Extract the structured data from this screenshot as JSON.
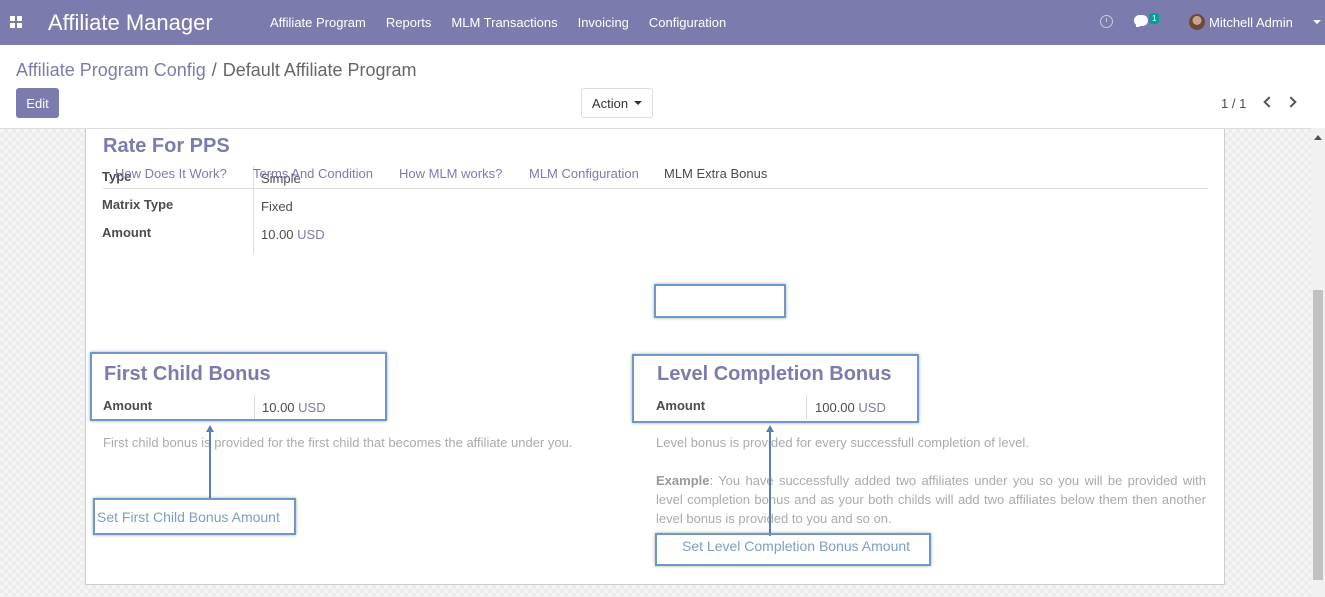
{
  "navbar": {
    "app_title": "Affiliate Manager",
    "menu": [
      "Affiliate Program",
      "Reports",
      "MLM Transactions",
      "Invoicing",
      "Configuration"
    ],
    "chat_badge": "1",
    "user_name": "Mitchell Admin"
  },
  "control": {
    "breadcrumb_parent": "Affiliate Program Config",
    "breadcrumb_sep": "/",
    "breadcrumb_current": "Default Affiliate Program",
    "edit_label": "Edit",
    "action_label": "Action",
    "pager": "1 / 1"
  },
  "rate_pps": {
    "title": "Rate For PPS",
    "type_label": "Type",
    "type_value": "Simple",
    "matrix_label": "Matrix Type",
    "matrix_value": "Fixed",
    "amount_label": "Amount",
    "amount_value": "10.00",
    "amount_currency": "USD"
  },
  "tabs": [
    "How Does It Work?",
    "Terms And Condition",
    "How MLM works?",
    "MLM Configuration",
    "MLM Extra Bonus"
  ],
  "first_child": {
    "title": "First Child Bonus",
    "amount_label": "Amount",
    "amount_value": "10.00",
    "currency": "USD",
    "description": "First child bonus is provided for the first child that becomes the affiliate under you.",
    "annotation": "Set First Child Bonus Amount"
  },
  "level_completion": {
    "title": "Level Completion Bonus",
    "amount_label": "Amount",
    "amount_value": "100.00",
    "currency": "USD",
    "description": "Level bonus is provided for every successfull completion of level.",
    "example_label": "Example",
    "example_text": ": You have successfully added two affiliates under you so you will be provided with level completion bonus and as your both childs will add two affiliates below them then another level bonus is provided to you and so on.",
    "annotation": "Set Level Completion Bonus Amount"
  }
}
